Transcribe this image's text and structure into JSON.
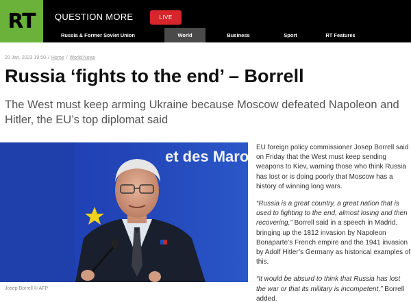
{
  "header": {
    "logo_text": "RT",
    "tagline": "QUESTION MORE",
    "live_label": "LIVE",
    "logo_color": "#6ab23a",
    "live_color": "#d6262b",
    "nav": [
      {
        "label": "Russia & Former Soviet Union",
        "active": false
      },
      {
        "label": "World News",
        "active": true
      },
      {
        "label": "Business",
        "active": false
      },
      {
        "label": "Sport",
        "active": false
      },
      {
        "label": "RT Features",
        "active": false
      }
    ]
  },
  "meta": {
    "date": "20 Jan, 2023 19:50",
    "breadcrumb_home": "Home",
    "breadcrumb_section": "World News"
  },
  "article": {
    "headline": "Russia ‘fights to the end’ – Borrell",
    "subhead": "The West must keep arming Ukraine because Moscow defeated Napoleon and Hitler, the EU’s top diplomat said",
    "photo_caption": "Josep Borrell © AFP",
    "photo_backdrop_text": "et des Marocai",
    "paragraphs": {
      "p1": "EU foreign policy commissioner Josep Borrell said on Friday that the West must keep sending weapons to Kiev, warning those who think Russia has lost or is doing poorly that Moscow has a history of winning long wars.",
      "p2_quote": "“Russia is a great country, a great nation that is used to fighting to the end, almost losing and then recovering,”",
      "p2_rest": " Borrell said in a speech in Madrid, bringing up the 1812 invasion by Napoleon Bonaparte’s French empire and the 1941 invasion by Adolf Hitler’s Germany as historical examples of this.",
      "p3_quote": "“It would be absurd to think that Russia has lost the war or that its military is incompetent,”",
      "p3_rest": " Borrell added."
    }
  }
}
